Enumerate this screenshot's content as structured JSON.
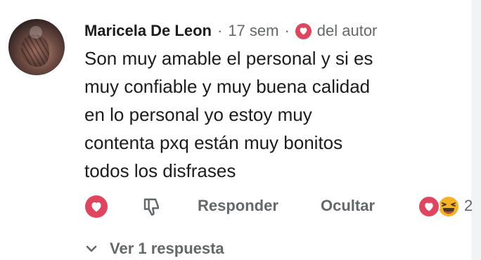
{
  "comment": {
    "author": "Maricela De Leon",
    "separator": "·",
    "time": "17 sem",
    "author_liked_label": "del autor",
    "text_lines": [
      "Son muy amable el personal y si es",
      "muy confiable y muy buena calidad",
      "en lo personal yo estoy muy",
      "contenta pxq están muy bonitos",
      "todos los disfrases"
    ]
  },
  "actions": {
    "reply_label": "Responder",
    "hide_label": "Ocultar",
    "reaction_count": "2"
  },
  "replies": {
    "label": "Ver 1 respuesta"
  },
  "icons": {
    "like": "heart-icon",
    "dislike": "thumbs-down-icon",
    "reaction_love": "heart-reaction-icon",
    "reaction_haha": "laughing-emoji-icon",
    "expand": "chevron-down-icon"
  },
  "colors": {
    "heart": "#e0455f",
    "secondary_text": "#65676b",
    "primary_text": "#1c1c1c",
    "laugh_emoji": "#f7b125"
  }
}
